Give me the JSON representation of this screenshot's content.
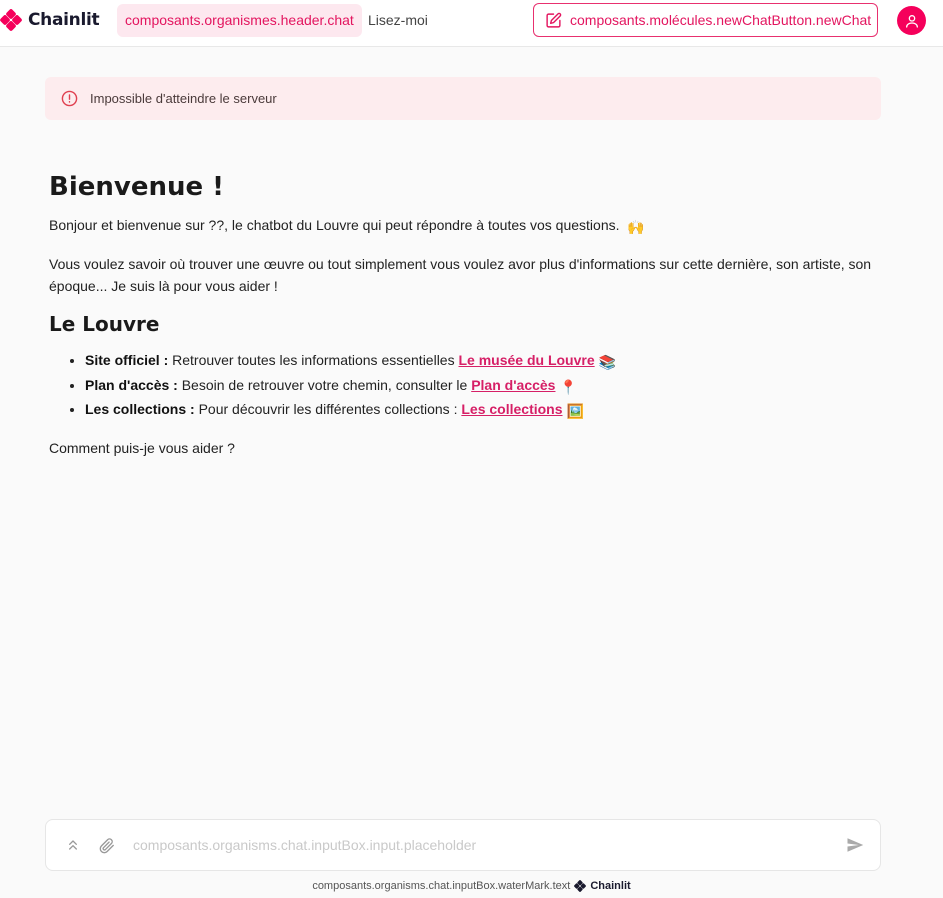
{
  "header": {
    "brand": "Chainlit",
    "nav_chat": "composants.organismes.header.chat",
    "nav_readme": "Lisez-moi",
    "new_chat": "composants.molécules.newChatButton.newChat",
    "accent": "#e3155f"
  },
  "alert": {
    "icon": "alert-circle-icon",
    "text": "Impossible d'atteindre le serveur"
  },
  "welcome": {
    "title": "Bienvenue !",
    "intro": "Bonjour et bienvenue sur ??, le chatbot du Louvre qui peut répondre à toutes vos questions.",
    "intro_emoji": "🙌",
    "description": "Vous voulez savoir où trouver une œuvre ou tout simplement vous voulez avor plus d'informations sur cette dernière, son artiste, son époque... Je suis là pour vous aider !",
    "section_title": "Le Louvre",
    "items": [
      {
        "label": "Site officiel :",
        "text": " Retrouver toutes les informations essentielles ",
        "link": "Le musée du Louvre",
        "emoji": "📚"
      },
      {
        "label": "Plan d'accès :",
        "text": " Besoin de retrouver votre chemin, consulter le ",
        "link": "Plan d'accès",
        "emoji": "📍"
      },
      {
        "label": "Les collections :",
        "text": " Pour découvrir les différentes collections : ",
        "link": "Les collections",
        "emoji": "🖼️"
      }
    ],
    "closing": "Comment puis-je vous aider ?"
  },
  "input": {
    "placeholder": "composants.organisms.chat.inputBox.input.placeholder"
  },
  "footer": {
    "watermark": "composants.organisms.chat.inputBox.waterMark.text",
    "brand": "Chainlit"
  }
}
